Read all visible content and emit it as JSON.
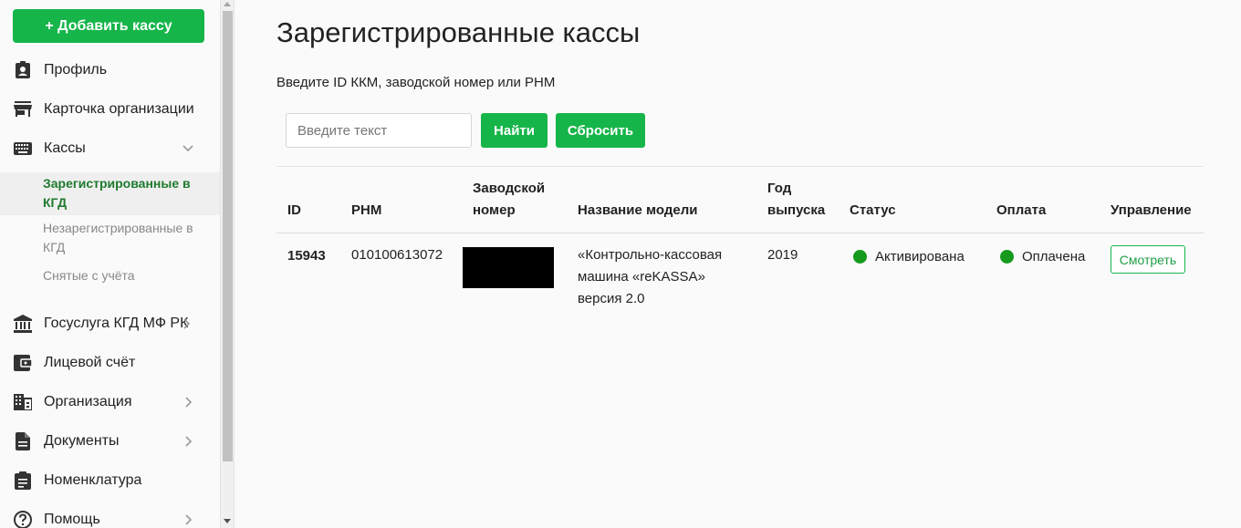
{
  "sidebar": {
    "add_button": "+ Добавить кассу",
    "items": [
      {
        "label": "Профиль",
        "icon": "profile-badge-icon"
      },
      {
        "label": "Карточка организации",
        "icon": "store-icon"
      },
      {
        "label": "Кассы",
        "icon": "keyboard-icon",
        "expanded": true
      },
      {
        "label": "Госуслуга КГД МФ РК",
        "icon": "bank-icon"
      },
      {
        "label": "Лицевой счёт",
        "icon": "wallet-icon"
      },
      {
        "label": "Организация",
        "icon": "building-icon"
      },
      {
        "label": "Документы",
        "icon": "document-icon"
      },
      {
        "label": "Номенклатура",
        "icon": "clipboard-icon"
      },
      {
        "label": "Помощь",
        "icon": "help-icon"
      }
    ],
    "sub_items": [
      {
        "label": "Зарегистрированные в КГД",
        "active": true
      },
      {
        "label": "Незарегистрированные в КГД",
        "active": false
      },
      {
        "label": "Снятые с учёта",
        "active": false
      }
    ]
  },
  "main": {
    "title": "Зарегистрированные кассы",
    "search_label": "Введите ID ККМ, заводской номер или РНМ",
    "search_placeholder": "Введите текст",
    "find_button": "Найти",
    "reset_button": "Сбросить",
    "table": {
      "headers": {
        "id": "ID",
        "rnm": "РНМ",
        "serial": "Заводской номер",
        "model": "Название модели",
        "year": "Год выпуска",
        "status": "Статус",
        "payment": "Оплата",
        "actions": "Управление"
      },
      "rows": [
        {
          "id": "15943",
          "rnm": "010100613072",
          "serial": "",
          "model": "«Контрольно-кассовая машина «reKASSA» версия 2.0",
          "year": "2019",
          "status": "Активирована",
          "payment": "Оплачена",
          "action": "Смотреть"
        }
      ]
    }
  },
  "colors": {
    "accent": "#16b54a",
    "status_dot": "#159a1e",
    "active_sub": "#1f7a2e"
  }
}
